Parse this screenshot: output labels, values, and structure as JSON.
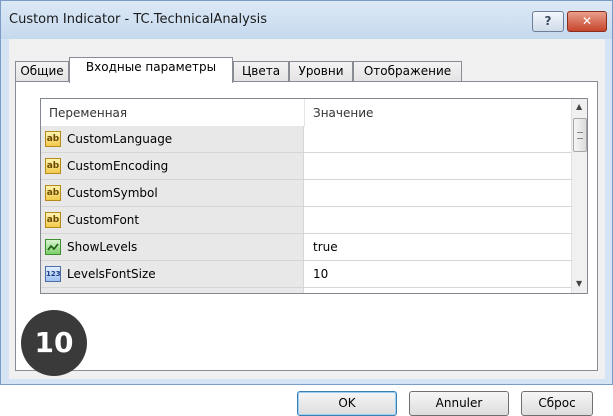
{
  "window": {
    "title": "Custom Indicator - TC.TechnicalAnalysis",
    "help_label": "?",
    "close_label": "✕"
  },
  "tabs": [
    {
      "label": "Общие"
    },
    {
      "label": "Входные параметры"
    },
    {
      "label": "Цвета"
    },
    {
      "label": "Уровни"
    },
    {
      "label": "Отображение"
    }
  ],
  "active_tab": "Входные параметры",
  "grid": {
    "headers": {
      "variable": "Переменная",
      "value": "Значение"
    },
    "rows": [
      {
        "name": "CustomLanguage",
        "value": "",
        "type_icon": "string-icon",
        "icon_text": "ab"
      },
      {
        "name": "CustomEncoding",
        "value": "",
        "type_icon": "string-icon",
        "icon_text": "ab"
      },
      {
        "name": "CustomSymbol",
        "value": "",
        "type_icon": "string-icon",
        "icon_text": "ab"
      },
      {
        "name": "CustomFont",
        "value": "",
        "type_icon": "string-icon",
        "icon_text": "ab"
      },
      {
        "name": "ShowLevels",
        "value": "true",
        "type_icon": "bool-icon",
        "icon_text": ""
      },
      {
        "name": "LevelsFontSize",
        "value": "10",
        "type_icon": "integer-icon",
        "icon_text": "123"
      }
    ]
  },
  "buttons": {
    "ok": "OK",
    "cancel": "Annuler",
    "reset": "Сброс"
  },
  "badge": "10",
  "colors": {
    "accent": "#3c7fb1",
    "close": "#c7442b"
  }
}
